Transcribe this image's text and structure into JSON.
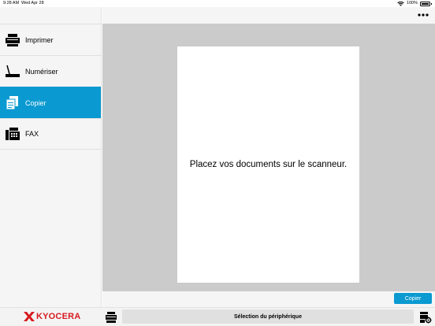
{
  "status_bar": {
    "time": "9:28 AM",
    "date": "Wed Apr 28",
    "battery": "100%"
  },
  "sidebar": {
    "items": [
      {
        "label": "Imprimer",
        "icon": "printer-icon",
        "active": false
      },
      {
        "label": "Numériser",
        "icon": "scanner-icon",
        "active": false
      },
      {
        "label": "Copier",
        "icon": "copy-icon",
        "active": true
      },
      {
        "label": "FAX",
        "icon": "fax-icon",
        "active": false
      }
    ]
  },
  "main": {
    "message": "Placez vos documents sur le scanneur."
  },
  "actions": {
    "copy_label": "Copier"
  },
  "bottom_bar": {
    "brand": "KYOCERA",
    "device_select_label": "Sélection du périphérique"
  },
  "colors": {
    "accent": "#0a9ad1",
    "brand": "#d71920"
  }
}
